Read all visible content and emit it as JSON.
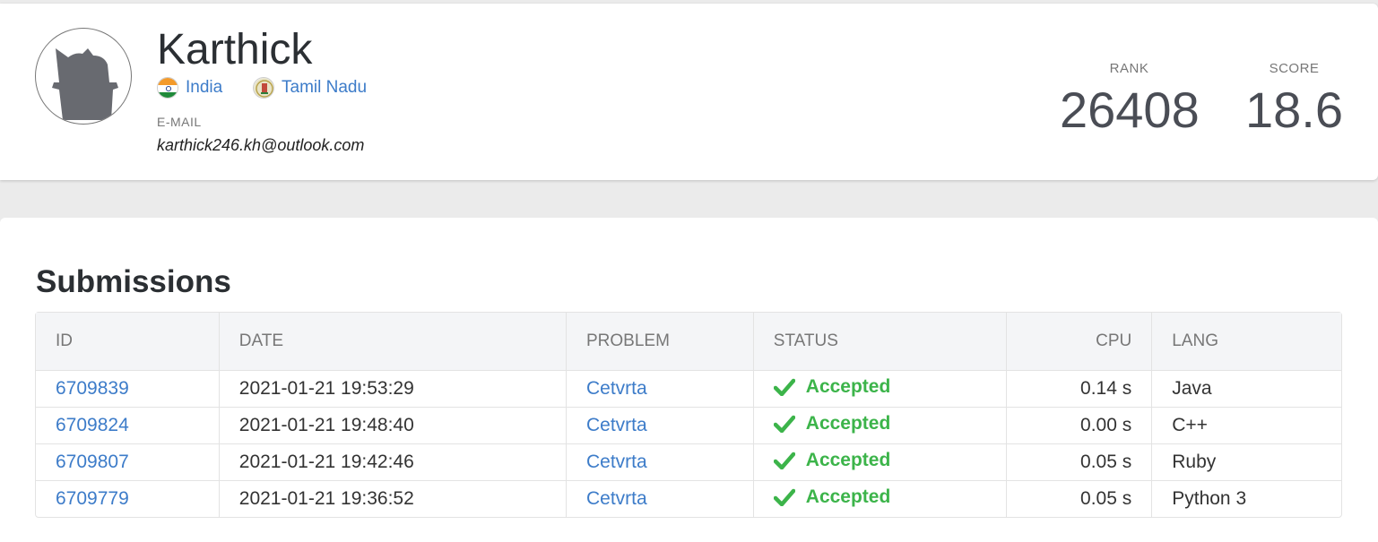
{
  "profile": {
    "name": "Karthick",
    "country": "India",
    "region": "Tamil Nadu",
    "email_label": "E-MAIL",
    "email": "karthick246.kh@outlook.com",
    "rank_label": "RANK",
    "rank": "26408",
    "score_label": "SCORE",
    "score": "18.6"
  },
  "submissions": {
    "title": "Submissions",
    "columns": {
      "id": "ID",
      "date": "DATE",
      "problem": "PROBLEM",
      "status": "STATUS",
      "cpu": "CPU",
      "lang": "LANG"
    },
    "rows": [
      {
        "id": "6709839",
        "date": "2021-01-21 19:53:29",
        "problem": "Cetvrta",
        "status": "Accepted",
        "cpu": "0.14 s",
        "lang": "Java"
      },
      {
        "id": "6709824",
        "date": "2021-01-21 19:48:40",
        "problem": "Cetvrta",
        "status": "Accepted",
        "cpu": "0.00 s",
        "lang": "C++"
      },
      {
        "id": "6709807",
        "date": "2021-01-21 19:42:46",
        "problem": "Cetvrta",
        "status": "Accepted",
        "cpu": "0.05 s",
        "lang": "Ruby"
      },
      {
        "id": "6709779",
        "date": "2021-01-21 19:36:52",
        "problem": "Cetvrta",
        "status": "Accepted",
        "cpu": "0.05 s",
        "lang": "Python 3"
      }
    ]
  },
  "colors": {
    "link": "#3d7cc9",
    "accepted": "#3cb44a"
  },
  "icons": {
    "avatar": "avatar-silhouette-icon",
    "country_flag": "india-flag-icon",
    "region_emblem": "tamil-nadu-emblem-icon",
    "status": "checkmark-icon"
  }
}
